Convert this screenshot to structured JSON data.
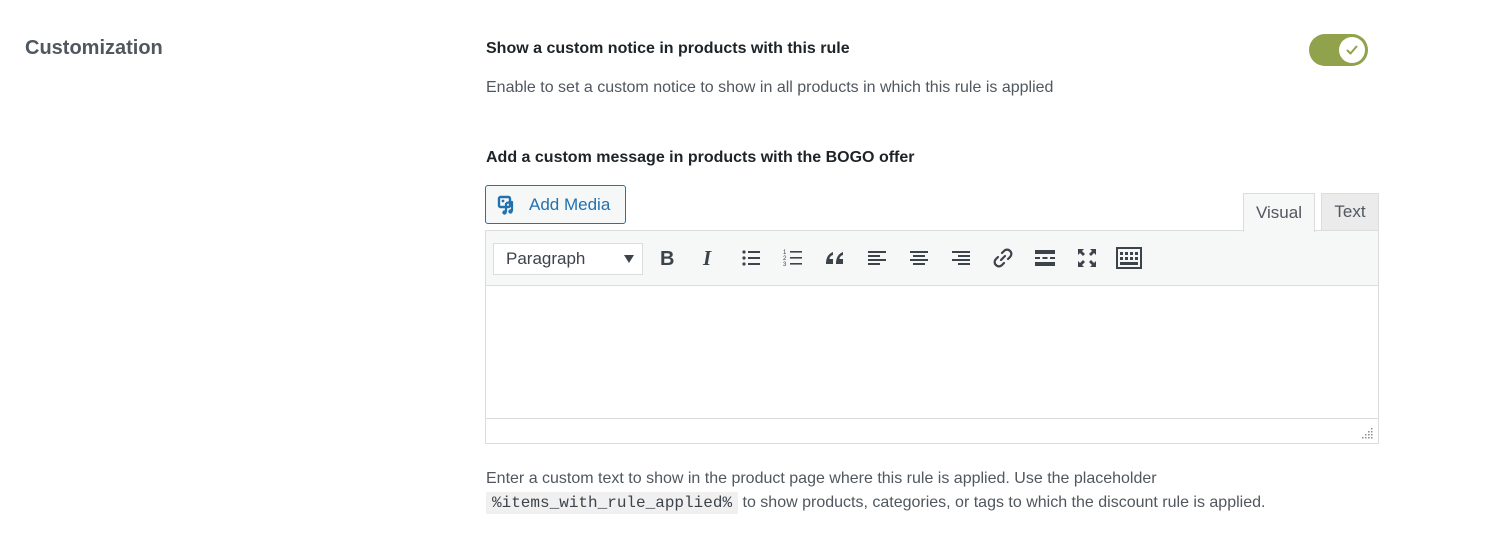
{
  "section": {
    "title": "Customization"
  },
  "notice_setting": {
    "title": "Show a custom notice in products with this rule",
    "description": "Enable to set a custom notice to show in all products in which this rule is applied",
    "toggle_on": true
  },
  "message_setting": {
    "title": "Add a custom message in products with the BOGO offer",
    "add_media_label": "Add Media",
    "tabs": [
      "Visual",
      "Text"
    ],
    "active_tab": "Visual",
    "format_select_value": "Paragraph",
    "toolbar_icons": [
      "bold-icon",
      "italic-icon",
      "bulleted-list-icon",
      "numbered-list-icon",
      "blockquote-icon",
      "align-left-icon",
      "align-center-icon",
      "align-right-icon",
      "link-icon",
      "read-more-icon",
      "fullscreen-icon",
      "toolbar-toggle-icon"
    ],
    "help_text_before": "Enter a custom text to show in the product page where this rule is applied. Use the placeholder",
    "help_placeholder": "%items_with_rule_applied%",
    "help_text_after": "to show products, categories, or tags to which the discount rule is applied."
  },
  "colors": {
    "toggle_on": "#90a24b",
    "link": "#2271b1"
  }
}
